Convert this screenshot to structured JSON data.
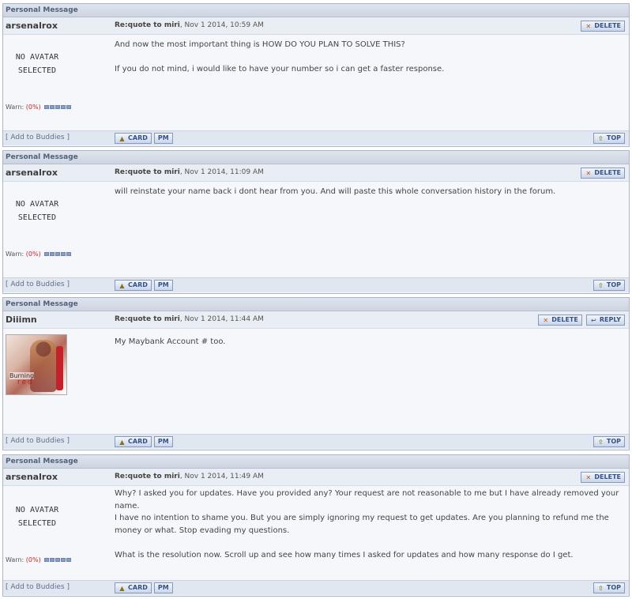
{
  "labels": {
    "header": "Personal Message",
    "delete": "DELETE",
    "reply": "REPLY",
    "add_buddies": "[ Add to Buddies ]",
    "card": "CARD",
    "pm": "PM",
    "top": "TOP",
    "no_avatar_1": "NO AVATAR",
    "no_avatar_2": "SELECTED",
    "warn_prefix": "Warn: ",
    "warn_pct": "(0%)",
    "subject": "Re:quote to miri"
  },
  "avatar_text": {
    "line1": "Burning",
    "line2": "red"
  },
  "icons": {
    "delete": "x-icon",
    "reply": "reply-icon",
    "card": "card-icon",
    "pm": "pm-icon",
    "top": "arrow-up-icon"
  },
  "messages": [
    {
      "author": "arsenalrox",
      "date": ", Nov 1 2014, 10:59 AM",
      "lines": [
        "And now the most important thing is HOW DO YOU PLAN TO SOLVE THIS?",
        "If you do not mind, i would like to have your number so i can get a faster response."
      ]
    },
    {
      "author": "arsenalrox",
      "date": ", Nov 1 2014, 11:09 AM",
      "lines": [
        "will reinstate your name back i dont hear from you. And will paste this whole conversation history in the forum."
      ]
    },
    {
      "author": "Diiimn",
      "date": ", Nov 1 2014, 11:44 AM",
      "lines": [
        "My Maybank Account # too."
      ]
    },
    {
      "author": "arsenalrox",
      "date": ", Nov 1 2014, 11:49 AM",
      "lines": [
        "Why? I asked you for updates. Have you provided any? Your request are not reasonable to me but I have already removed your name.",
        "I have no intention to shame you. But you are simply ignoring my request to get updates. Are you planning to refund me the money or what. Stop evading my questions.",
        "What is the resolution now. Scroll up and see how many times I asked for updates and how many response do I get."
      ]
    }
  ]
}
